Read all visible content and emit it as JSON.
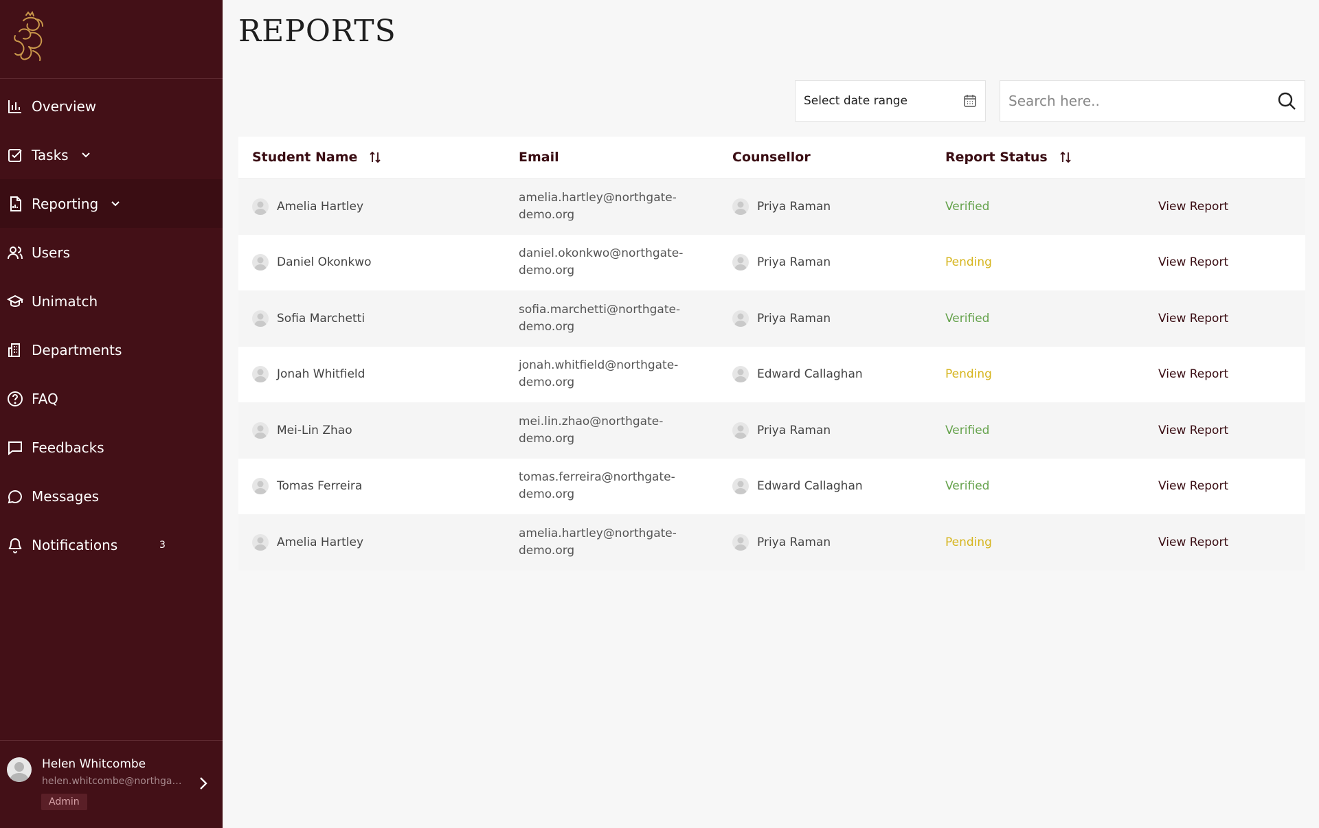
{
  "sidebar": {
    "items": [
      {
        "label": "Overview"
      },
      {
        "label": "Tasks"
      },
      {
        "label": "Reporting"
      },
      {
        "label": "Users"
      },
      {
        "label": "Unimatch"
      },
      {
        "label": "Departments"
      },
      {
        "label": "FAQ"
      },
      {
        "label": "Feedbacks"
      },
      {
        "label": "Messages"
      },
      {
        "label": "Notifications",
        "badge": "3"
      }
    ],
    "profile": {
      "name": "Helen Whitcombe",
      "email": "helen.whitcombe@northgate-demo.org",
      "role": "Admin"
    }
  },
  "page": {
    "title": "REPORTS"
  },
  "filters": {
    "date_range_label": "Select date range",
    "search_placeholder": "Search here.."
  },
  "table": {
    "headers": {
      "student": "Student Name",
      "email": "Email",
      "counsellor": "Counsellor",
      "status": "Report Status"
    },
    "rows": [
      {
        "student": "Amelia Hartley",
        "email_1": "amelia.hartley@northgate-",
        "email_2": "demo.org",
        "counsellor": "Priya Raman",
        "status": "Verified",
        "action": "View Report"
      },
      {
        "student": "Daniel Okonkwo",
        "email_1": "daniel.okonkwo@northgate-",
        "email_2": "demo.org",
        "counsellor": "Priya Raman",
        "status": "Pending",
        "action": "View Report"
      },
      {
        "student": "Sofia Marchetti",
        "email_1": "sofia.marchetti@northgate-",
        "email_2": "demo.org",
        "counsellor": "Priya Raman",
        "status": "Verified",
        "action": "View Report"
      },
      {
        "student": "Jonah Whitfield",
        "email_1": "jonah.whitfield@northgate-",
        "email_2": "demo.org",
        "counsellor": "Edward Callaghan",
        "status": "Pending",
        "action": "View Report"
      },
      {
        "student": "Mei-Lin Zhao",
        "email_1": "mei.lin.zhao@northgate-",
        "email_2": "demo.org",
        "counsellor": "Priya Raman",
        "status": "Verified",
        "action": "View Report"
      },
      {
        "student": "Tomas Ferreira",
        "email_1": "tomas.ferreira@northgate-",
        "email_2": "demo.org",
        "counsellor": "Edward Callaghan",
        "status": "Verified",
        "action": "View Report"
      },
      {
        "student": "Amelia Hartley",
        "email_1": "amelia.hartley@northgate-",
        "email_2": "demo.org",
        "counsellor": "Priya Raman",
        "status": "Pending",
        "action": "View Report"
      }
    ]
  },
  "colors": {
    "sidebar_bg": "#431017",
    "accent": "#3a0d13",
    "verified": "#66a34d",
    "pending": "#d6b51e",
    "logo_gold": "#c9974b"
  }
}
